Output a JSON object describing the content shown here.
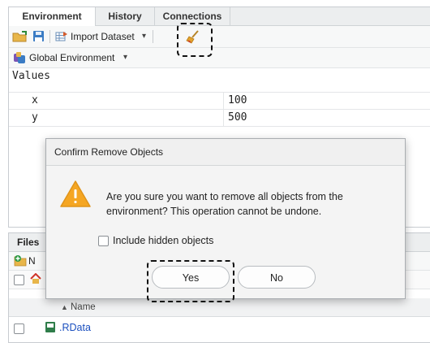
{
  "env_tabs": [
    "Environment",
    "History",
    "Connections"
  ],
  "toolbar": {
    "import_label": "Import Dataset",
    "dropdown_glyph": "▾"
  },
  "scope": {
    "label": "Global Environment",
    "dropdown_glyph": "▾"
  },
  "values_header": "Values",
  "variables": [
    {
      "name": "x",
      "value": "100"
    },
    {
      "name": "y",
      "value": "500"
    }
  ],
  "files": {
    "tab": "Files",
    "new_label_partial": "N",
    "col_sort_glyph": "▲",
    "col_name": "Name",
    "row_name": ".RData"
  },
  "dialog": {
    "title": "Confirm Remove Objects",
    "message": "Are you sure you want to remove all objects from the environment? This operation cannot be undone.",
    "checkbox_label": "Include hidden objects",
    "checkbox_checked": false,
    "yes": "Yes",
    "no": "No"
  },
  "icons": [
    "open-folder-icon",
    "save-icon",
    "import-dataset-icon",
    "broom-icon",
    "r-logo-icon",
    "warning-icon",
    "home-icon",
    "new-folder-icon",
    "rdata-file-icon"
  ],
  "colors": {
    "warning": "#f5a623",
    "accent": "#3b7cc4",
    "highlight": "#111111"
  }
}
